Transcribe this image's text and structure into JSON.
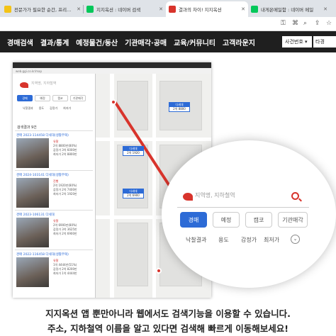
{
  "browser": {
    "tabs": [
      {
        "title": "전문가가 필요한 순간, 프리랜서 마켓",
        "favicon_color": "#f3c316",
        "active": false
      },
      {
        "title": "지지옥션 : 네이버 검색",
        "favicon_color": "#03c75a",
        "active": false
      },
      {
        "title": "결과의 차이! 지지옥션",
        "favicon_color": "#d8342c",
        "active": true
      },
      {
        "title": "내게온메일함 : 네이버 메일",
        "favicon_color": "#03c75a",
        "active": false
      }
    ]
  },
  "site_nav": {
    "items": [
      "경매검색",
      "결과/통계",
      "예정물건/동산",
      "기관매각·공매",
      "교육/커뮤니티",
      "고객라운지"
    ],
    "select_label": "사건번호",
    "select2_label": "타경"
  },
  "screenshot": {
    "url": "web.ggi.co.kr/map",
    "search_placeholder": "지역명, 지하철역",
    "buttons": [
      "경매",
      "예정",
      "캠코",
      "기관매각"
    ],
    "filters": [
      "낙찰결과",
      "용도",
      "감정가",
      "최저가"
    ],
    "results_header": "검색결과 9건",
    "listings": [
      {
        "label": "경매 2023-114458 다세대(생활주택)",
        "status": "유찰",
        "price": "2억 8800만(80%)",
        "detail1": "감정가 3억 6000만",
        "detail2": "최저가 2억 8800만"
      },
      {
        "label": "경매 2024-103141 다세대(생활주택)",
        "status": "진행",
        "price": "2억 1920만(80%)",
        "detail1": "감정가 2억 7400만",
        "detail2": "최저가 2억 1920만"
      },
      {
        "label": "경매 2023-106131 다세대",
        "status": "유찰",
        "price": "2억 6900만(80%)",
        "detail1": "감정가 3억 3625만",
        "detail2": "최저가 2억 6900만"
      },
      {
        "label": "경매 2022-116458 다세대(생활주택)",
        "status": "유찰",
        "price": "1억 4444만(51%)",
        "detail1": "감정가 2억 8200만",
        "detail2": "최저가 1억 4444만"
      }
    ],
    "map_tags": [
      {
        "head": "다세대",
        "body": "2억 8800"
      },
      {
        "head": "다세대",
        "body": "2억 1920"
      },
      {
        "head": "다세대",
        "body": "2억 6900"
      }
    ]
  },
  "zoom": {
    "search_placeholder": "지역명, 지하철역",
    "buttons": [
      "경매",
      "예정",
      "캠코",
      "기관매각"
    ],
    "filters": [
      "낙찰결과",
      "용도",
      "감정가",
      "최저가"
    ]
  },
  "caption": {
    "line1": "지지옥션 앱 뿐만아니라 웹에서도 검색기능을 이용할 수 있습니다.",
    "line2": "주소, 지하철역 이름을 알고 있다면 검색해 빠르게 이동해보세요!"
  },
  "colors": {
    "accent": "#d8342c",
    "primary": "#2d6bd6",
    "nav_bg": "#1f1f1f"
  }
}
